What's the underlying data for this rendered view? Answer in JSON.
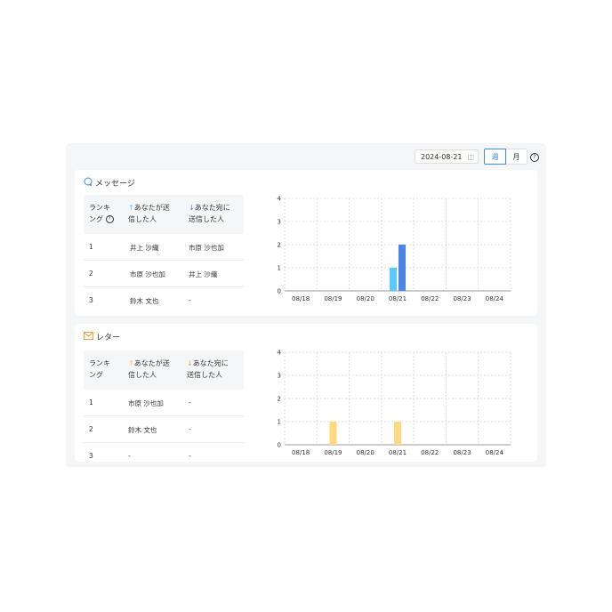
{
  "date_picker": {
    "value": "2024-08-21",
    "icon": "calendar-icon"
  },
  "period": {
    "week": "週",
    "month": "月",
    "help": "?"
  },
  "message_card": {
    "title": "メッセージ",
    "icon": "chat-bubble-icon",
    "headers": {
      "rank_line1": "ランキ",
      "rank_line2": "ング",
      "sent_line1": "あなたが送",
      "sent_line2": "信した人",
      "recv_line1": "あなた宛に",
      "recv_line2": "送信した人"
    },
    "rows": [
      {
        "rank": "1",
        "sent": "井上 沙織",
        "recv": "市原 沙也加"
      },
      {
        "rank": "2",
        "sent": "市原 沙也加",
        "recv": "井上 沙織"
      },
      {
        "rank": "3",
        "sent": "鈴木 文也",
        "recv": "-"
      }
    ]
  },
  "letter_card": {
    "title": "レター",
    "icon": "envelope-icon",
    "headers": {
      "rank_line1": "ランキ",
      "rank_line2": "ング",
      "sent_line1": "あなたが送",
      "sent_line2": "信した人",
      "recv_line1": "あなた宛に",
      "recv_line2": "送信した人"
    },
    "rows": [
      {
        "rank": "1",
        "sent": "市原 沙也加",
        "recv": "-"
      },
      {
        "rank": "2",
        "sent": "鈴木 文也",
        "recv": "-"
      },
      {
        "rank": "3",
        "sent": "-",
        "recv": "-"
      }
    ]
  },
  "chart_data": [
    {
      "type": "bar",
      "categories": [
        "08/18",
        "08/19",
        "08/20",
        "08/21",
        "08/22",
        "08/23",
        "08/24"
      ],
      "series": [
        {
          "color": "#5ac8fa",
          "values": [
            0,
            0,
            0,
            1,
            0,
            0,
            0
          ]
        },
        {
          "color": "#4a86e8",
          "values": [
            0,
            0,
            0,
            2,
            0,
            0,
            0
          ]
        }
      ],
      "ylim": [
        0,
        4
      ],
      "yticks": [
        0,
        1,
        2,
        3,
        4
      ],
      "grid": true
    },
    {
      "type": "bar",
      "categories": [
        "08/18",
        "08/19",
        "08/20",
        "08/21",
        "08/22",
        "08/23",
        "08/24"
      ],
      "series": [
        {
          "color": "#ffd980",
          "values": [
            0,
            1,
            0,
            1,
            0,
            0,
            0
          ]
        }
      ],
      "ylim": [
        0,
        4
      ],
      "yticks": [
        0,
        1,
        2,
        3,
        4
      ],
      "grid": true
    }
  ]
}
